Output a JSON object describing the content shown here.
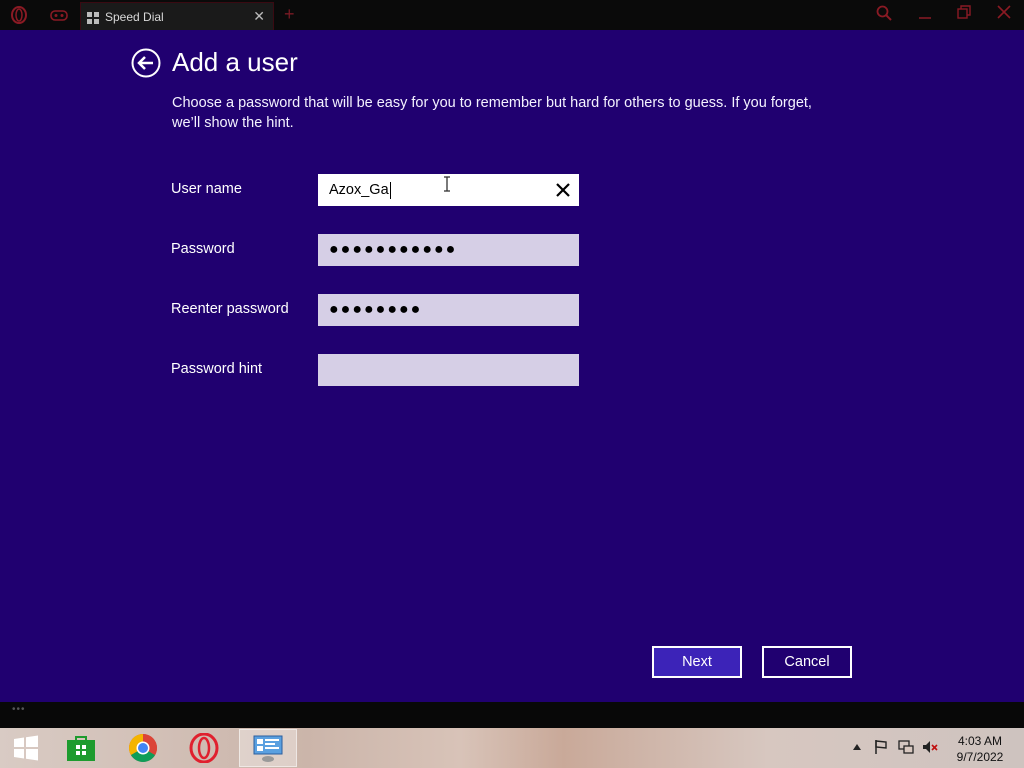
{
  "browser": {
    "tab_title": "Speed Dial",
    "tab_close_glyph": "✕",
    "new_tab_glyph": "+",
    "icons": [
      "opera-logo-icon",
      "game-controller-icon",
      "speed-dial-grid-icon",
      "search-icon",
      "minimize-icon",
      "restore-icon",
      "close-icon"
    ]
  },
  "page": {
    "title": "Add a user",
    "instructions": "Choose a password that will be easy for you to remember but hard for others to guess. If you forget, we’ll show the hint."
  },
  "form": {
    "username": {
      "label": "User name",
      "value": "Azox_Ga"
    },
    "password": {
      "label": "Password",
      "masked_value": "●●●●●●●●●●●"
    },
    "reenter": {
      "label": "Reenter password",
      "masked_value": "●●●●●●●●"
    },
    "hint": {
      "label": "Password hint",
      "value": ""
    }
  },
  "buttons": {
    "next": "Next",
    "cancel": "Cancel"
  },
  "taskbar": {
    "apps": [
      "windows-start-icon",
      "store-icon",
      "chrome-icon",
      "opera-icon",
      "control-panel-icon"
    ],
    "tray_icons": [
      "show-hidden-icons-chevron",
      "action-center-flag-icon",
      "network-icon",
      "volume-muted-icon"
    ],
    "time": "4:03 AM",
    "date": "9/7/2022"
  },
  "colors": {
    "background": "#200070",
    "accent": "#3c23b8",
    "field": "#d6cfe6"
  }
}
